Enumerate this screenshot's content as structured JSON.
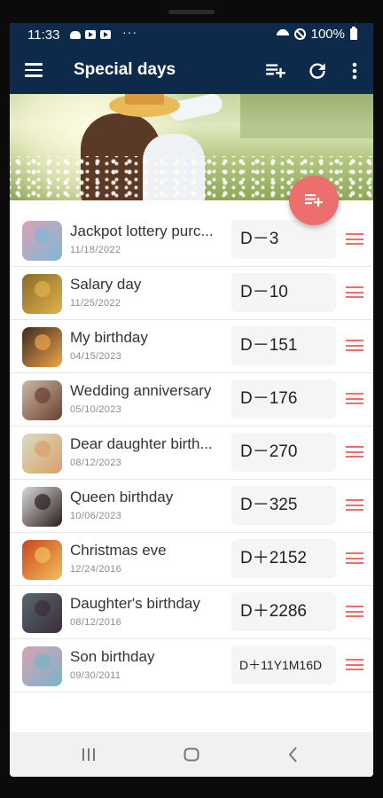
{
  "status_bar": {
    "time": "11:33",
    "dots": "···",
    "battery": "100%"
  },
  "app_bar": {
    "title": "Special days",
    "icons": [
      "menu-icon",
      "playlist-add-icon",
      "refresh-icon",
      "more-vert-icon"
    ]
  },
  "colors": {
    "app_bar": "#0e2a4a",
    "accent": "#ec6f6d",
    "dday_bg": "#f5f5f5"
  },
  "events": [
    {
      "name": "Jackpot lottery purc...",
      "date": "11/18/2022",
      "dday": "D－3",
      "thumb": "party"
    },
    {
      "name": "Salary day",
      "date": "11/25/2022",
      "dday": "D－10",
      "thumb": "coins"
    },
    {
      "name": "My birthday",
      "date": "04/15/2023",
      "dday": "D－151",
      "thumb": "street"
    },
    {
      "name": "Wedding anniversary",
      "date": "05/10/2023",
      "dday": "D－176",
      "thumb": "woman"
    },
    {
      "name": "Dear daughter birth...",
      "date": "08/12/2023",
      "dday": "D－270",
      "thumb": "girl"
    },
    {
      "name": "Queen birthday",
      "date": "10/06/2023",
      "dday": "D－325",
      "thumb": "portrait"
    },
    {
      "name": "Christmas eve",
      "date": "12/24/2016",
      "dday": "D＋2152",
      "thumb": "cake"
    },
    {
      "name": "Daughter's birthday",
      "date": "08/12/2016",
      "dday": "D＋2286",
      "thumb": "outdoor"
    },
    {
      "name": "Son birthday",
      "date": "09/30/2011",
      "dday": "D＋11Y1M16D",
      "thumb": "party2"
    }
  ]
}
